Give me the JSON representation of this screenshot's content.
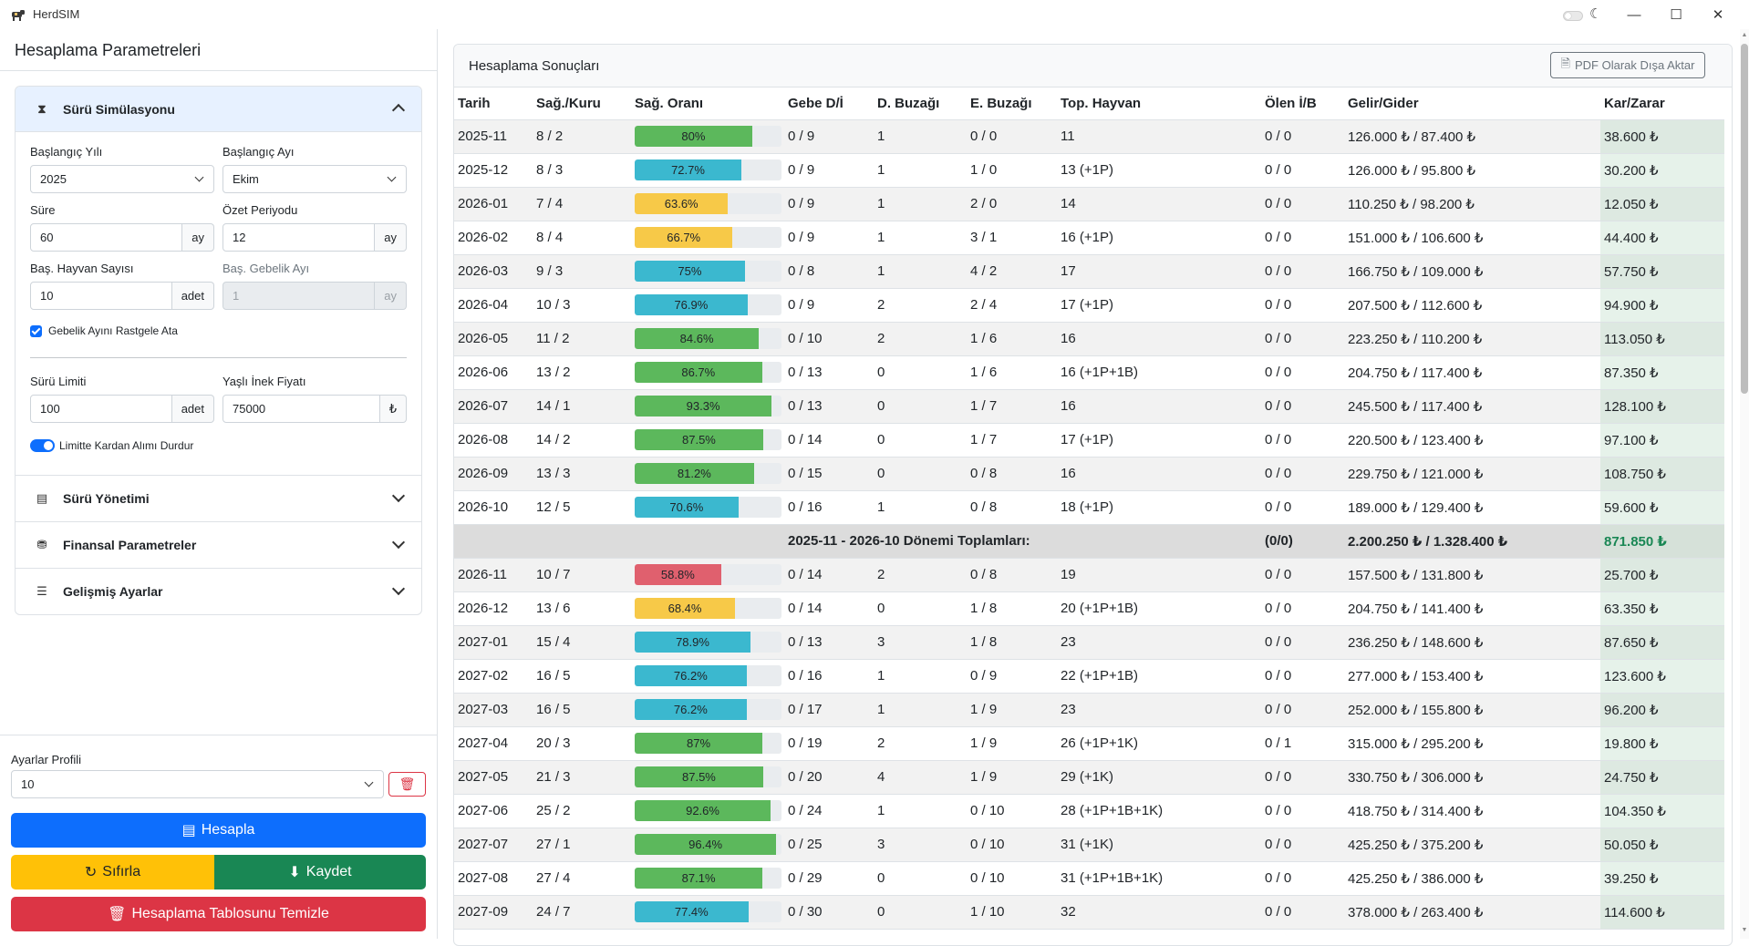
{
  "window": {
    "title": "HerdSIM",
    "minimize_glyph": "—",
    "maximize_glyph": "☐",
    "close_glyph": "✕",
    "moon_glyph": "☾"
  },
  "left": {
    "title": "Hesaplama Parametreleri",
    "sections": {
      "simulation": {
        "label": "Sürü Simülasyonu",
        "icon": "hourglass-icon",
        "icon_glyph": "⧗"
      },
      "management": {
        "label": "Sürü Yönetimi",
        "icon": "clipboard-icon",
        "icon_glyph": "▤"
      },
      "financial": {
        "label": "Finansal Parametreler",
        "icon": "money-icon",
        "icon_glyph": "⛃"
      },
      "advanced": {
        "label": "Gelişmiş Ayarlar",
        "icon": "sliders-icon",
        "icon_glyph": "☰"
      }
    },
    "form": {
      "start_year_label": "Başlangıç Yılı",
      "start_year_value": "2025",
      "start_month_label": "Başlangıç Ayı",
      "start_month_value": "Ekim",
      "duration_label": "Süre",
      "duration_value": "60",
      "duration_unit": "ay",
      "summary_period_label": "Özet Periyodu",
      "summary_period_value": "12",
      "summary_period_unit": "ay",
      "start_animals_label": "Baş. Hayvan Sayısı",
      "start_animals_value": "10",
      "start_animals_unit": "adet",
      "start_pregnancy_label": "Baş. Gebelik Ayı",
      "start_pregnancy_value": "1",
      "start_pregnancy_unit": "ay",
      "random_pregnancy_label": "Gebelik Ayını Rastgele Ata",
      "herd_limit_label": "Sürü Limiti",
      "herd_limit_value": "100",
      "herd_limit_unit": "adet",
      "old_cow_price_label": "Yaşlı İnek Fiyatı",
      "old_cow_price_value": "75000",
      "old_cow_price_unit": "₺",
      "stop_buying_label": "Limitte Kardan Alımı Durdur"
    },
    "profile_label": "Ayarlar Profili",
    "profile_value": "10",
    "trash_glyph": "🗑",
    "buttons": {
      "calculate": "Hesapla",
      "calculate_glyph": "▤",
      "reset": "Sıfırla",
      "reset_glyph": "↻",
      "save": "Kaydet",
      "save_glyph": "⬇",
      "clear": "Hesaplama Tablosunu Temizle",
      "clear_glyph": "🗑"
    },
    "colors": {
      "primary": "#0d6efd",
      "warning": "#ffc107",
      "success": "#198754",
      "danger": "#dc3545"
    }
  },
  "results": {
    "title": "Hesaplama Sonuçları",
    "pdf_button": "PDF Olarak Dışa Aktar",
    "pdf_glyph": "🗎",
    "columns": [
      "Tarih",
      "Sağ./Kuru",
      "Sağ. Oranı",
      "Gebe D/İ",
      "D. Buzağı",
      "E. Buzağı",
      "Top. Hayvan",
      "Ölen İ/B",
      "Gelir/Gider",
      "Kar/Zarar"
    ],
    "rows": [
      {
        "date": "2025-11",
        "milk_dry": "8 / 2",
        "rate": 80,
        "rate_text": "80%",
        "color": "green",
        "preg": "0 / 9",
        "f_calf": "1",
        "m_calf": "0 / 0",
        "total": "11",
        "dead": "0 / 0",
        "income": "126.000 ₺ / 87.400 ₺",
        "profit": "38.600 ₺"
      },
      {
        "date": "2025-12",
        "milk_dry": "8 / 3",
        "rate": 72.7,
        "rate_text": "72.7%",
        "color": "teal",
        "preg": "0 / 9",
        "f_calf": "1",
        "m_calf": "1 / 0",
        "total": "13 (+1P)",
        "dead": "0 / 0",
        "income": "126.000 ₺ / 95.800 ₺",
        "profit": "30.200 ₺"
      },
      {
        "date": "2026-01",
        "milk_dry": "7 / 4",
        "rate": 63.6,
        "rate_text": "63.6%",
        "color": "yellow",
        "preg": "0 / 9",
        "f_calf": "1",
        "m_calf": "2 / 0",
        "total": "14",
        "dead": "0 / 0",
        "income": "110.250 ₺ / 98.200 ₺",
        "profit": "12.050 ₺"
      },
      {
        "date": "2026-02",
        "milk_dry": "8 / 4",
        "rate": 66.7,
        "rate_text": "66.7%",
        "color": "yellow",
        "preg": "0 / 9",
        "f_calf": "1",
        "m_calf": "3 / 1",
        "total": "16 (+1P)",
        "dead": "0 / 0",
        "income": "151.000 ₺ / 106.600 ₺",
        "profit": "44.400 ₺"
      },
      {
        "date": "2026-03",
        "milk_dry": "9 / 3",
        "rate": 75,
        "rate_text": "75%",
        "color": "teal",
        "preg": "0 / 8",
        "f_calf": "1",
        "m_calf": "4 / 2",
        "total": "17",
        "dead": "0 / 0",
        "income": "166.750 ₺ / 109.000 ₺",
        "profit": "57.750 ₺"
      },
      {
        "date": "2026-04",
        "milk_dry": "10 / 3",
        "rate": 76.9,
        "rate_text": "76.9%",
        "color": "teal",
        "preg": "0 / 9",
        "f_calf": "2",
        "m_calf": "2 / 4",
        "total": "17 (+1P)",
        "dead": "0 / 0",
        "income": "207.500 ₺ / 112.600 ₺",
        "profit": "94.900 ₺"
      },
      {
        "date": "2026-05",
        "milk_dry": "11 / 2",
        "rate": 84.6,
        "rate_text": "84.6%",
        "color": "green",
        "preg": "0 / 10",
        "f_calf": "2",
        "m_calf": "1 / 6",
        "total": "16",
        "dead": "0 / 0",
        "income": "223.250 ₺ / 110.200 ₺",
        "profit": "113.050 ₺"
      },
      {
        "date": "2026-06",
        "milk_dry": "13 / 2",
        "rate": 86.7,
        "rate_text": "86.7%",
        "color": "green",
        "preg": "0 / 13",
        "f_calf": "0",
        "m_calf": "1 / 6",
        "total": "16 (+1P+1B)",
        "dead": "0 / 0",
        "income": "204.750 ₺ / 117.400 ₺",
        "profit": "87.350 ₺"
      },
      {
        "date": "2026-07",
        "milk_dry": "14 / 1",
        "rate": 93.3,
        "rate_text": "93.3%",
        "color": "green",
        "preg": "0 / 13",
        "f_calf": "0",
        "m_calf": "1 / 7",
        "total": "16",
        "dead": "0 / 0",
        "income": "245.500 ₺ / 117.400 ₺",
        "profit": "128.100 ₺"
      },
      {
        "date": "2026-08",
        "milk_dry": "14 / 2",
        "rate": 87.5,
        "rate_text": "87.5%",
        "color": "green",
        "preg": "0 / 14",
        "f_calf": "0",
        "m_calf": "1 / 7",
        "total": "17 (+1P)",
        "dead": "0 / 0",
        "income": "220.500 ₺ / 123.400 ₺",
        "profit": "97.100 ₺"
      },
      {
        "date": "2026-09",
        "milk_dry": "13 / 3",
        "rate": 81.2,
        "rate_text": "81.2%",
        "color": "green",
        "preg": "0 / 15",
        "f_calf": "0",
        "m_calf": "0 / 8",
        "total": "16",
        "dead": "0 / 0",
        "income": "229.750 ₺ / 121.000 ₺",
        "profit": "108.750 ₺"
      },
      {
        "date": "2026-10",
        "milk_dry": "12 / 5",
        "rate": 70.6,
        "rate_text": "70.6%",
        "color": "teal",
        "preg": "0 / 16",
        "f_calf": "1",
        "m_calf": "0 / 8",
        "total": "18 (+1P)",
        "dead": "0 / 0",
        "income": "189.000 ₺ / 129.400 ₺",
        "profit": "59.600 ₺"
      }
    ],
    "total": {
      "label": "2025-11 - 2026-10 Dönemi Toplamları:",
      "dead": "(0/0)",
      "income": "2.200.250 ₺ / 1.328.400 ₺",
      "profit": "871.850 ₺"
    },
    "rows2": [
      {
        "date": "2026-11",
        "milk_dry": "10 / 7",
        "rate": 58.8,
        "rate_text": "58.8%",
        "color": "red",
        "preg": "0 / 14",
        "f_calf": "2",
        "m_calf": "0 / 8",
        "total": "19",
        "dead": "0 / 0",
        "income": "157.500 ₺ / 131.800 ₺",
        "profit": "25.700 ₺"
      },
      {
        "date": "2026-12",
        "milk_dry": "13 / 6",
        "rate": 68.4,
        "rate_text": "68.4%",
        "color": "yellow",
        "preg": "0 / 14",
        "f_calf": "0",
        "m_calf": "1 / 8",
        "total": "20 (+1P+1B)",
        "dead": "0 / 0",
        "income": "204.750 ₺ / 141.400 ₺",
        "profit": "63.350 ₺"
      },
      {
        "date": "2027-01",
        "milk_dry": "15 / 4",
        "rate": 78.9,
        "rate_text": "78.9%",
        "color": "teal",
        "preg": "0 / 13",
        "f_calf": "3",
        "m_calf": "1 / 8",
        "total": "23",
        "dead": "0 / 0",
        "income": "236.250 ₺ / 148.600 ₺",
        "profit": "87.650 ₺"
      },
      {
        "date": "2027-02",
        "milk_dry": "16 / 5",
        "rate": 76.2,
        "rate_text": "76.2%",
        "color": "teal",
        "preg": "0 / 16",
        "f_calf": "1",
        "m_calf": "0 / 9",
        "total": "22 (+1P+1B)",
        "dead": "0 / 0",
        "income": "277.000 ₺ / 153.400 ₺",
        "profit": "123.600 ₺"
      },
      {
        "date": "2027-03",
        "milk_dry": "16 / 5",
        "rate": 76.2,
        "rate_text": "76.2%",
        "color": "teal",
        "preg": "0 / 17",
        "f_calf": "1",
        "m_calf": "1 / 9",
        "total": "23",
        "dead": "0 / 0",
        "income": "252.000 ₺ / 155.800 ₺",
        "profit": "96.200 ₺"
      },
      {
        "date": "2027-04",
        "milk_dry": "20 / 3",
        "rate": 87,
        "rate_text": "87%",
        "color": "green",
        "preg": "0 / 19",
        "f_calf": "2",
        "m_calf": "1 / 9",
        "total": "26 (+1P+1K)",
        "dead": "0 / 1",
        "income": "315.000 ₺ / 295.200 ₺",
        "profit": "19.800 ₺"
      },
      {
        "date": "2027-05",
        "milk_dry": "21 / 3",
        "rate": 87.5,
        "rate_text": "87.5%",
        "color": "green",
        "preg": "0 / 20",
        "f_calf": "4",
        "m_calf": "1 / 9",
        "total": "29 (+1K)",
        "dead": "0 / 0",
        "income": "330.750 ₺ / 306.000 ₺",
        "profit": "24.750 ₺"
      },
      {
        "date": "2027-06",
        "milk_dry": "25 / 2",
        "rate": 92.6,
        "rate_text": "92.6%",
        "color": "green",
        "preg": "0 / 24",
        "f_calf": "1",
        "m_calf": "0 / 10",
        "total": "28 (+1P+1B+1K)",
        "dead": "0 / 0",
        "income": "418.750 ₺ / 314.400 ₺",
        "profit": "104.350 ₺"
      },
      {
        "date": "2027-07",
        "milk_dry": "27 / 1",
        "rate": 96.4,
        "rate_text": "96.4%",
        "color": "green",
        "preg": "0 / 25",
        "f_calf": "3",
        "m_calf": "0 / 10",
        "total": "31 (+1K)",
        "dead": "0 / 0",
        "income": "425.250 ₺ / 375.200 ₺",
        "profit": "50.050 ₺"
      },
      {
        "date": "2027-08",
        "milk_dry": "27 / 4",
        "rate": 87.1,
        "rate_text": "87.1%",
        "color": "green",
        "preg": "0 / 29",
        "f_calf": "0",
        "m_calf": "0 / 10",
        "total": "31 (+1P+1B+1K)",
        "dead": "0 / 0",
        "income": "425.250 ₺ / 386.000 ₺",
        "profit": "39.250 ₺"
      },
      {
        "date": "2027-09",
        "milk_dry": "24 / 7",
        "rate": 77.4,
        "rate_text": "77.4%",
        "color": "teal",
        "preg": "0 / 30",
        "f_calf": "0",
        "m_calf": "1 / 10",
        "total": "32",
        "dead": "0 / 0",
        "income": "378.000 ₺ / 263.400 ₺",
        "profit": "114.600 ₺"
      }
    ],
    "bar_colors": {
      "green": "#5cb85c",
      "teal": "#3bb8cf",
      "yellow": "#f7c948",
      "red": "#e0606e"
    }
  }
}
